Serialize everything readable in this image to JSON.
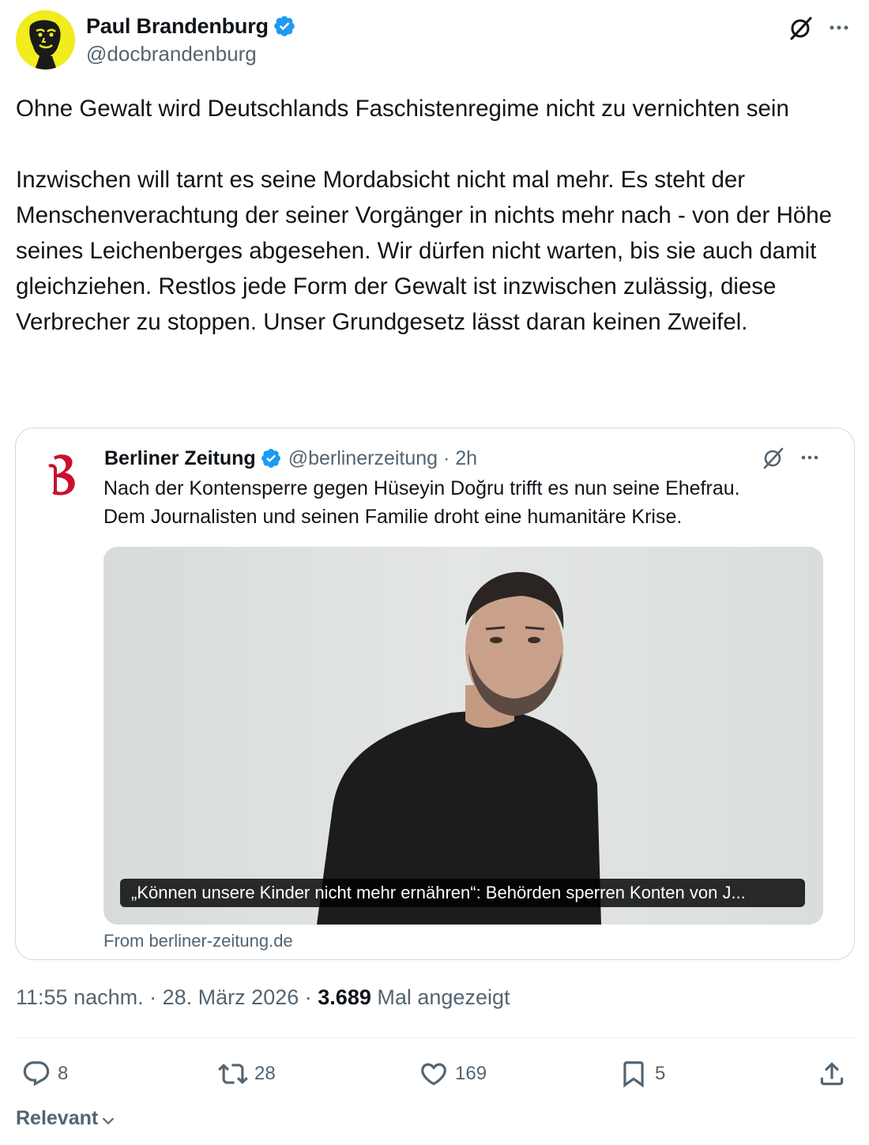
{
  "author": {
    "name": "Paul Brandenburg",
    "handle": "@docbrandenburg"
  },
  "tweet": {
    "text": "Ohne Gewalt wird Deutschlands Faschistenregime nicht zu vernichten sein\n\nInzwischen will tarnt es seine Mordabsicht nicht mal mehr. Es steht der Menschenverachtung der seiner Vorgänger in nichts mehr nach - von der Höhe seines Leichenberges abgesehen. Wir dürfen nicht warten, bis sie auch damit gleichziehen. Restlos jede Form der Gewalt ist inzwischen zulässig, diese Verbrecher zu stoppen. Unser Grundgesetz lässt daran keinen Zweifel."
  },
  "quote": {
    "name": "Berliner Zeitung",
    "handle_time": "@berlinerzeitung · 2h",
    "text": "Nach der Kontensperre gegen Hüseyin Doğru trifft es nun seine Ehefrau.\nDem Journalisten und seinen Familie droht eine humanitäre Krise.",
    "image_caption": "„Können unsere Kinder nicht mehr ernähren“: Behörden sperren Konten von J...",
    "source": "From berliner-zeitung.de"
  },
  "meta": {
    "time": "11:55 nachm.",
    "date": "28. März 2026",
    "views": "3.689",
    "views_label": "Mal angezeigt",
    "sep": "·"
  },
  "actions": {
    "replies": "8",
    "retweets": "28",
    "likes": "169",
    "bookmarks": "5"
  },
  "sort": {
    "label": "Relevant"
  },
  "icons": {
    "verified": "verified-badge-icon",
    "grok": "grok-icon",
    "more": "more-icon",
    "reply": "reply-icon",
    "retweet": "retweet-icon",
    "like": "heart-icon",
    "bookmark": "bookmark-icon",
    "share": "share-icon",
    "chevron": "chevron-down-icon"
  },
  "colors": {
    "verified": "#1d9bf0",
    "text": "#0f1419",
    "muted": "#536471",
    "avatar_bg": "#f1ec1e",
    "bz_red": "#c8102e"
  }
}
